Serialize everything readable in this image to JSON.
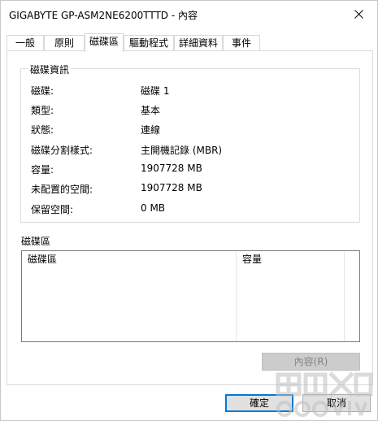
{
  "window": {
    "title": "GIGABYTE GP-ASM2NE6200TTTD - 內容"
  },
  "tabs": [
    {
      "label": "一般"
    },
    {
      "label": "原則"
    },
    {
      "label": "磁碟區"
    },
    {
      "label": "驅動程式"
    },
    {
      "label": "詳細資料"
    },
    {
      "label": "事件"
    }
  ],
  "active_tab": "磁碟區",
  "disk_info": {
    "group_title": "磁碟資訊",
    "rows": [
      {
        "label": "磁碟:",
        "value": "磁碟 1"
      },
      {
        "label": "類型:",
        "value": "基本"
      },
      {
        "label": "狀態:",
        "value": "連線"
      },
      {
        "label": "磁碟分割樣式:",
        "value": "主開機記錄 (MBR)"
      },
      {
        "label": "容量:",
        "value": "1907728 MB"
      },
      {
        "label": "未配置的空間:",
        "value": "1907728 MB"
      },
      {
        "label": "保留空間:",
        "value": "0 MB"
      }
    ]
  },
  "volumes": {
    "section_label": "磁碟區",
    "columns": [
      "磁碟區",
      "容量"
    ]
  },
  "buttons": {
    "properties": "內容(R)",
    "ok": "確定",
    "cancel": "取消"
  },
  "colors": {
    "accent": "#0078d7",
    "disabled_button": "#cccccc"
  }
}
